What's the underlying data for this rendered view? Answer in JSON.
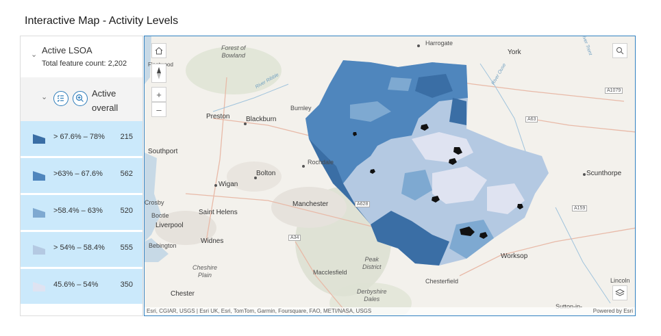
{
  "page": {
    "title": "Interactive Map - Activity Levels"
  },
  "legend": {
    "layer_title": "Active LSOA",
    "feature_count": "Total feature count: 2,202",
    "sub_title": "Active overall",
    "classes": [
      {
        "label": "> 67.6% – 78%",
        "count": "215",
        "color": "#3a6ea5"
      },
      {
        "label": ">63% – 67.6%",
        "count": "562",
        "color": "#4f86bd"
      },
      {
        "label": ">58.4% – 63%",
        "count": "520",
        "color": "#7ea9d1"
      },
      {
        "label": "> 54% – 58.4%",
        "count": "555",
        "color": "#b4c9e2"
      },
      {
        "label": "45.6% – 54%",
        "count": "350",
        "color": "#dfe3f1"
      }
    ]
  },
  "map": {
    "attribution_left": "Esri, CGIAR, USGS | Esri UK, Esri, TomTom, Garmin, Foursquare, FAO, METI/NASA, USGS",
    "attribution_right": "Powered by Esri",
    "zoom_in": "+",
    "zoom_out": "–",
    "places": [
      {
        "name": "Harrogate",
        "cls": "lg"
      },
      {
        "name": "York",
        "cls": "lg"
      },
      {
        "name": "Preston",
        "cls": "lg"
      },
      {
        "name": "Blackburn",
        "cls": "lg"
      },
      {
        "name": "Burnley",
        "cls": ""
      },
      {
        "name": "Southport",
        "cls": "lg"
      },
      {
        "name": "Rochdale",
        "cls": ""
      },
      {
        "name": "Bolton",
        "cls": "lg"
      },
      {
        "name": "Wigan",
        "cls": "lg"
      },
      {
        "name": "Manchester",
        "cls": "lg"
      },
      {
        "name": "Crosby",
        "cls": ""
      },
      {
        "name": "Saint Helens",
        "cls": "lg"
      },
      {
        "name": "Bootle",
        "cls": ""
      },
      {
        "name": "Liverpool",
        "cls": "lg"
      },
      {
        "name": "Bebington",
        "cls": ""
      },
      {
        "name": "Widnes",
        "cls": "lg"
      },
      {
        "name": "Chester",
        "cls": "lg"
      },
      {
        "name": "Macclesfield",
        "cls": ""
      },
      {
        "name": "Chesterfield",
        "cls": ""
      },
      {
        "name": "Worksop",
        "cls": "lg"
      },
      {
        "name": "Scunthorpe",
        "cls": "lg"
      },
      {
        "name": "Lincoln",
        "cls": ""
      },
      {
        "name": "Sutton-in-",
        "cls": ""
      },
      {
        "name": "Fleetwood",
        "cls": ""
      }
    ],
    "natural": [
      {
        "name": "Forest of\nBowland"
      },
      {
        "name": "Cheshire\nPlain"
      },
      {
        "name": "Peak\nDistrict"
      },
      {
        "name": "Derbyshire\nDales"
      }
    ],
    "roads": [
      {
        "name": "A1079"
      },
      {
        "name": "A63"
      },
      {
        "name": "A628"
      },
      {
        "name": "A34"
      },
      {
        "name": "A159"
      }
    ],
    "rivers": [
      {
        "name": "River Ribble"
      },
      {
        "name": "River Ouse"
      },
      {
        "name": "River Trent"
      }
    ]
  }
}
